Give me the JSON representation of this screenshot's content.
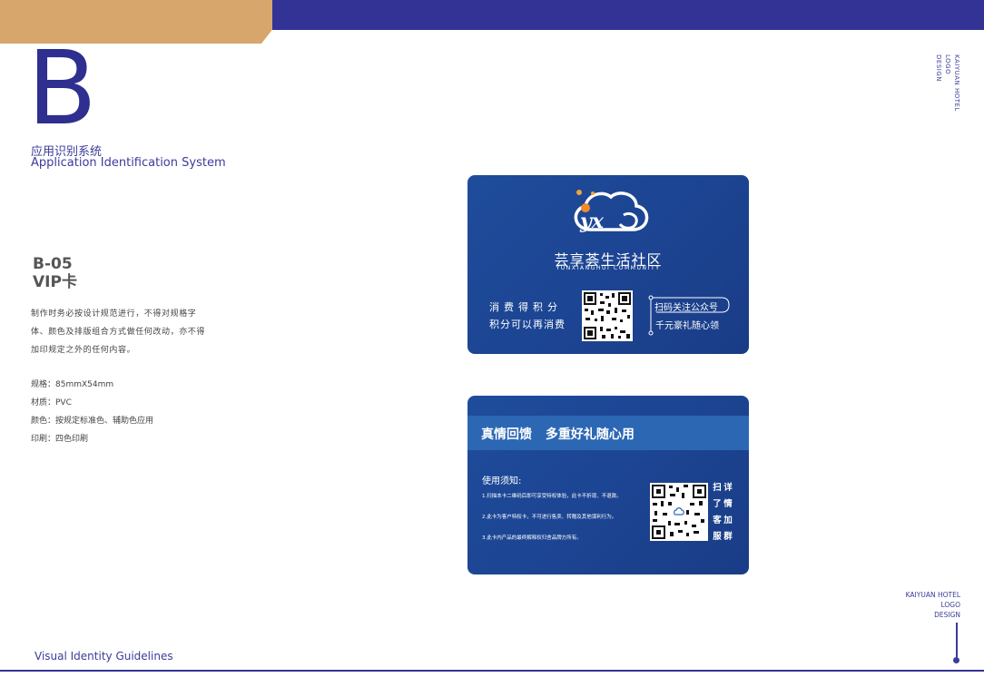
{
  "header": {
    "section_letter": "B",
    "section_cn": "应用识别系统",
    "section_en": "Application Identification System"
  },
  "item": {
    "code": "B-05",
    "name": "VIP卡"
  },
  "description": "制作时务必按设计规范进行，不得对规格字体、颜色及排版组合方式做任何改动，亦不得加印规定之外的任何内容。",
  "specs": [
    "规格：85mmX54mm",
    "材质：PVC",
    "颜色：按规定标准色、辅助色应用",
    "印刷：四色印刷"
  ],
  "brand": {
    "line1": "KAIYUAN HOTEL",
    "line2": "LOGO",
    "line3": "DESIGN"
  },
  "footer": {
    "text": "Visual Identity Guidelines"
  },
  "card_front": {
    "brand_cn": "芸享荟生活社区",
    "brand_en": "YUNXIANGHUI COMMUNITY",
    "earn_line1": "消费得积分",
    "earn_line2": "积分可以再消费",
    "scan_line1": "扫码关注公众号",
    "scan_line2": "千元豪礼随心领"
  },
  "card_back": {
    "title": "真情回馈 多重好礼随心用",
    "notice_title": "使用须知:",
    "rules": [
      "1.扫描本卡二维码后即可享受特权体验，此卡不折现、不退款。",
      "2.此卡为客户特权卡，不可进行售卖、转赠及其他谋利行为。",
      "3.此卡内产品的最终解释权归舍品牌方所有。"
    ],
    "side_col1": "详情",
    "side_col2": "扫了",
    "side_col3": "客服",
    "side_col4": "加群"
  },
  "colors": {
    "primary": "#323395",
    "accent": "#d7a66c",
    "card": "#1f4c9b"
  }
}
